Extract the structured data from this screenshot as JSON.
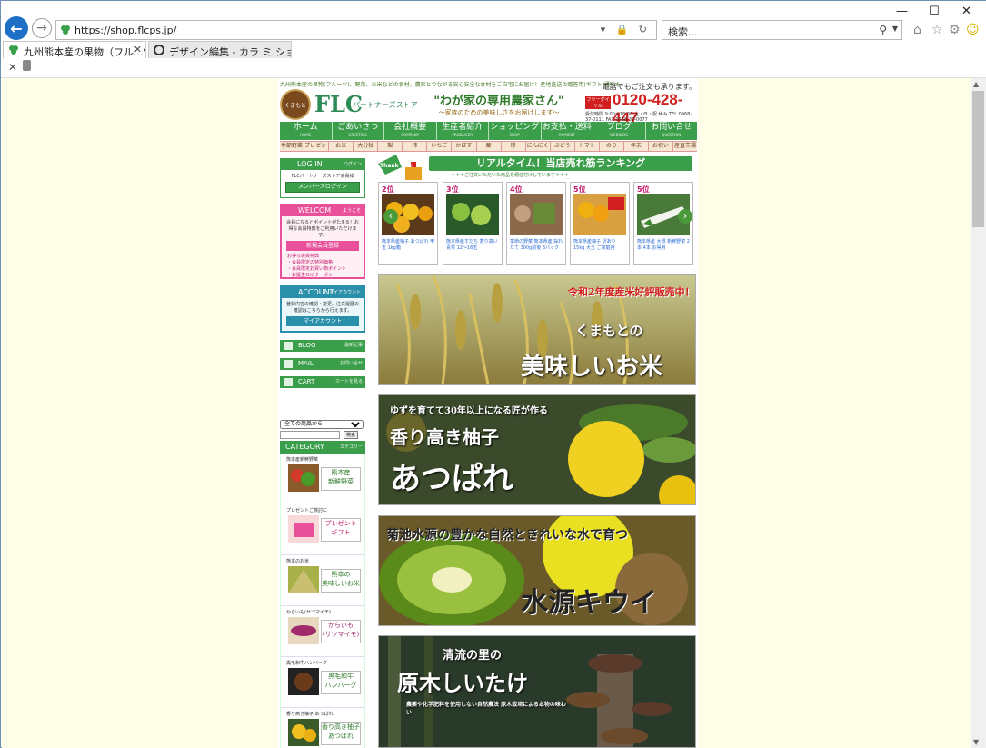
{
  "browser": {
    "url": "https://shop.flcps.jp/",
    "search_placeholder": "検索...",
    "tabs": [
      {
        "label": "九州熊本産の果物（フル...ツ..."
      },
      {
        "label": "デザイン編集 - カラ ミ ショップ"
      }
    ],
    "window_controls": [
      "—",
      "☐",
      "✕"
    ]
  },
  "site": {
    "tagline": "九州熊本産の果物(フルーツ)、野菜、お米などの食材。農家とつながる安心安全な食材をご自宅にお届け！産地直送の贈答用(ギフト)通販も！",
    "logo_badge": "くまもと",
    "logo_text": "FLC",
    "logo_sub": "パートナーズストア",
    "slogan_main": "\"わが家の専用農家さん\"",
    "slogan_sub": "～家族のための美味しさをお届けします～",
    "phone_note": "電話でもご注文も承ります。",
    "phone_badge": "フリーダイヤル",
    "phone_number": "0120-428-447",
    "phone_hours": "受付時間 9:00～18:00 土・日・祝 休み TEL 0968-37-0111 FAX 0968-37-0077",
    "gnav": [
      {
        "label": "ホーム",
        "en": "HOME"
      },
      {
        "label": "ごあいさつ",
        "en": "GREETING"
      },
      {
        "label": "会社概要",
        "en": "COMPANY"
      },
      {
        "label": "生産者紹介",
        "en": "PRODUCER"
      },
      {
        "label": "ショッピング",
        "en": "SHOP"
      },
      {
        "label": "お支払・送料",
        "en": "PAYMENT"
      },
      {
        "label": "ブログ",
        "en": "WEBBLOG"
      },
      {
        "label": "お問い合せ",
        "en": "QUESTION"
      }
    ],
    "subnav": [
      "季節野菜",
      "プレゼント",
      "お米",
      "大分柚",
      "梨",
      "柿",
      "いちご",
      "かぼす",
      "栗",
      "柿",
      "にんにく",
      "ぶどう",
      "トマト",
      "のり",
      "年末",
      "お祝い",
      "産直市場"
    ]
  },
  "sidebar": {
    "login_title": "LOG IN",
    "login_small": "ログイン",
    "login_text": "FLCパートナーズストア会員様",
    "login_button": "メンバーズログイン",
    "welcome_title": "WELCOM",
    "welcome_small": "ようこそ",
    "welcome_text": "会員になるとポイントがたまる！お得な会員特典をご利用いただけます。",
    "welcome_button": "新規会員登録",
    "welcome_perks": "お得な会員特典\n・会員限定の特別価格\n・会員限定お買い物ポイント\n・お誕生日にクーポン",
    "account_title": "ACCOUNT",
    "account_small": "マイアカウント",
    "account_text": "登録内容の確認・変更、注文履歴の確認はこちらから行えます。",
    "account_button": "マイアカウント",
    "blog_label": "BLOG",
    "blog_small": "最新記事",
    "mail_label": "MAIL",
    "mail_small": "お問い合せ",
    "cart_label": "CART",
    "cart_small": "カートを見る",
    "search_select": "全ての商品から",
    "search_go": "検索",
    "category_title": "CATEGORY",
    "category_small": "カテゴリー",
    "categories": [
      {
        "label": "熊本産新鮮野菜",
        "tile": "熊本産\n新鮮野菜"
      },
      {
        "label": "プレゼントご検討に",
        "tile": "プレゼント\nギフト"
      },
      {
        "label": "熊本のお米",
        "tile": "熊本の\n美味しいお米"
      },
      {
        "label": "からいも(サツマイモ)",
        "tile": "からいも\n(サツマイモ)"
      },
      {
        "label": "黒毛和牛ハンバーグ",
        "tile": "黒毛和牛\nハンバーグ"
      },
      {
        "label": "香り高き柚子 あつぱれ",
        "tile": "香り高き柚子\nあつぱれ"
      }
    ]
  },
  "main": {
    "ranking_title": "リアルタイム！当店売れ筋ランキング",
    "ranking_thanks": "Thank You!",
    "ranking_sub": "＊＊＊ご注文いただいた商品を順位付けしています＊＊＊",
    "ranking": [
      {
        "rank": "2位",
        "title": "熊本県産柚子 あつぱれ 甲玉 1kg箱"
      },
      {
        "rank": "3位",
        "title": "熊本県産すだち 香り高い青果 12～16玉"
      },
      {
        "rank": "4位",
        "title": "季節の野菜 熊本県産 採れたて 300g前後 3パック"
      },
      {
        "rank": "5位",
        "title": "熊本県産柚子 訳あり 15kg 大玉 ご家庭用"
      },
      {
        "rank": "5位",
        "title": "熊本県産 大根 新鮮野菜 2本 4本 お得用"
      }
    ],
    "banners": [
      {
        "name": "rice",
        "line1": "令和2年度産米好評販売中！",
        "line2": "くまもとの",
        "line3": "美味しいお米"
      },
      {
        "name": "yuzu",
        "line1": "ゆずを育てて30年以上になる匠が作る",
        "line2": "香り高き柚子",
        "line3": "あつぱれ"
      },
      {
        "name": "kiwi",
        "line1": "菊池水源の豊かな自然ときれいな水で育つ",
        "line2": "水源キウイ",
        "line3": ""
      },
      {
        "name": "shiitake",
        "line1": "清流の里の",
        "line2": "原木しいたけ",
        "line3": "農薬や化学肥料を使用しない自然農法 原木栽培による本物の味わい"
      }
    ]
  },
  "colors": {
    "brand_green": "#3a9e4a",
    "phone_red": "#d21f1f",
    "welcome_pink": "#e8509a",
    "account_teal": "#2a8fa8",
    "page_bg": "#fefee8"
  }
}
